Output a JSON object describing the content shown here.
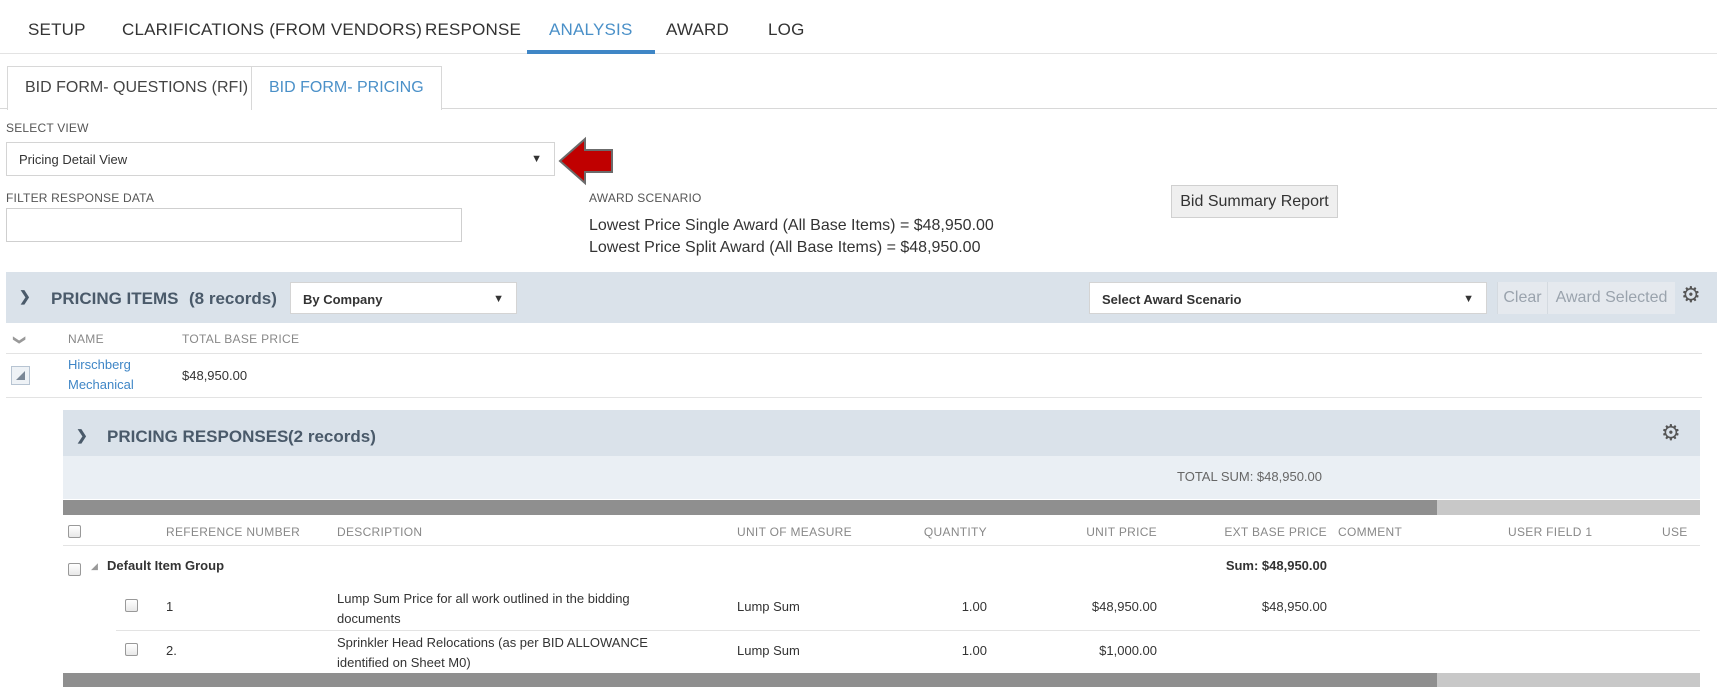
{
  "top_tabs": [
    "SETUP",
    "CLARIFICATIONS (FROM VENDORS)",
    "RESPONSE",
    "ANALYSIS",
    "AWARD",
    "LOG"
  ],
  "active_top_tab": "ANALYSIS",
  "sub_tabs": [
    "BID FORM- QUESTIONS (RFI)",
    "BID FORM- PRICING"
  ],
  "active_sub_tab": "BID FORM- PRICING",
  "select_view": {
    "label": "SELECT VIEW",
    "value": "Pricing Detail View"
  },
  "filter": {
    "label": "FILTER RESPONSE DATA",
    "value": ""
  },
  "award_scenario": {
    "label": "AWARD SCENARIO",
    "line1": "Lowest Price Single Award (All Base Items) = $48,950.00",
    "line2": "Lowest Price Split Award (All Base Items) = $48,950.00"
  },
  "bid_summary_button": "Bid Summary Report",
  "pricing_items": {
    "title": "PRICING ITEMS",
    "count": "(8 records)",
    "group_by": "By Company",
    "award_scenario_select": "Select Award Scenario",
    "clear_label": "Clear",
    "award_selected_label": "Award Selected",
    "columns": [
      "NAME",
      "TOTAL BASE PRICE"
    ],
    "row": {
      "name_line1": "Hirschberg",
      "name_line2": "Mechanical",
      "total": "$48,950.00"
    }
  },
  "pricing_responses": {
    "title": "PRICING RESPONSES",
    "count": "(2 records)",
    "total_sum": "TOTAL SUM: $48,950.00",
    "columns": {
      "ref": "REFERENCE NUMBER",
      "desc": "DESCRIPTION",
      "uom": "UNIT OF MEASURE",
      "qty": "QUANTITY",
      "unit": "UNIT PRICE",
      "ext": "EXT BASE PRICE",
      "comment": "COMMENT",
      "uf1": "USER FIELD 1",
      "uf2": "USE"
    },
    "group": {
      "name": "Default Item Group",
      "sum": "Sum: $48,950.00"
    },
    "rows": [
      {
        "ref": "1",
        "desc1": "Lump Sum Price for all work outlined in the bidding",
        "desc2": "documents",
        "uom": "Lump Sum",
        "qty": "1.00",
        "unit": "$48,950.00",
        "ext": "$48,950.00"
      },
      {
        "ref": "2.",
        "desc1": "Sprinkler Head Relocations (as per BID ALLOWANCE",
        "desc2": "identified on Sheet M0)",
        "uom": "Lump Sum",
        "qty": "1.00",
        "unit": "$1,000.00",
        "ext": ""
      }
    ]
  },
  "colors": {
    "accent": "#3f86c6",
    "band": "#dae2ea",
    "arrow": "#c00000"
  }
}
